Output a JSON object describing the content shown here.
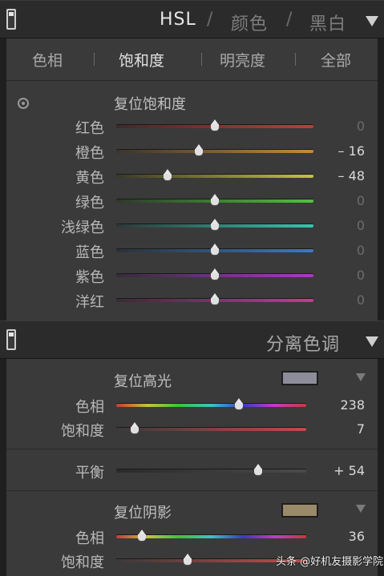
{
  "hsl_panel": {
    "header": {
      "hsl": "HSL",
      "sep1": "/",
      "color": "颜色",
      "sep2": "/",
      "bw": "黑白"
    },
    "tabs": [
      "色相",
      "饱和度",
      "明亮度",
      "全部"
    ],
    "active_tab": "饱和度",
    "reset_label": "复位饱和度",
    "rows": [
      {
        "label": "红色",
        "value": "0",
        "level": 0.5,
        "gradient": "linear-gradient(90deg,#3c2b2b,#c43a3a)"
      },
      {
        "label": "橙色",
        "value": "– 16",
        "level": 0.42,
        "gradient": "linear-gradient(90deg,#3b332b,#c78a3a)"
      },
      {
        "label": "黄色",
        "value": "– 48",
        "level": 0.26,
        "gradient": "linear-gradient(90deg,#38382b,#c4c43a)"
      },
      {
        "label": "绿色",
        "value": "0",
        "level": 0.5,
        "gradient": "linear-gradient(90deg,#2d382b,#4fc43a)"
      },
      {
        "label": "浅绿色",
        "value": "0",
        "level": 0.5,
        "gradient": "linear-gradient(90deg,#2b3836,#3ac4b0)"
      },
      {
        "label": "蓝色",
        "value": "0",
        "level": 0.5,
        "gradient": "linear-gradient(90deg,#2b3138,#3a7ac4)"
      },
      {
        "label": "紫色",
        "value": "0",
        "level": 0.5,
        "gradient": "linear-gradient(90deg,#352b38,#a83ac4)"
      },
      {
        "label": "洋红",
        "value": "0",
        "level": 0.5,
        "gradient": "linear-gradient(90deg,#382b34,#c43a9a)"
      }
    ]
  },
  "split_panel": {
    "header": "分离色调",
    "highlights": {
      "reset_label": "复位高光",
      "swatch_color": "#8c8c9a",
      "hue": {
        "label": "色相",
        "value": "238",
        "level": 0.66
      },
      "saturation": {
        "label": "饱和度",
        "value": "7",
        "level": 0.07
      }
    },
    "balance": {
      "label": "平衡",
      "value": "+ 54",
      "level": 0.77
    },
    "shadows": {
      "reset_label": "复位阴影",
      "swatch_color": "#9a8a6a",
      "hue": {
        "label": "色相",
        "value": "36",
        "level": 0.1
      },
      "saturation": {
        "label": "饱和度",
        "value": "",
        "level": 0.38
      }
    }
  },
  "watermark": "头条 @好机友摄影学院"
}
